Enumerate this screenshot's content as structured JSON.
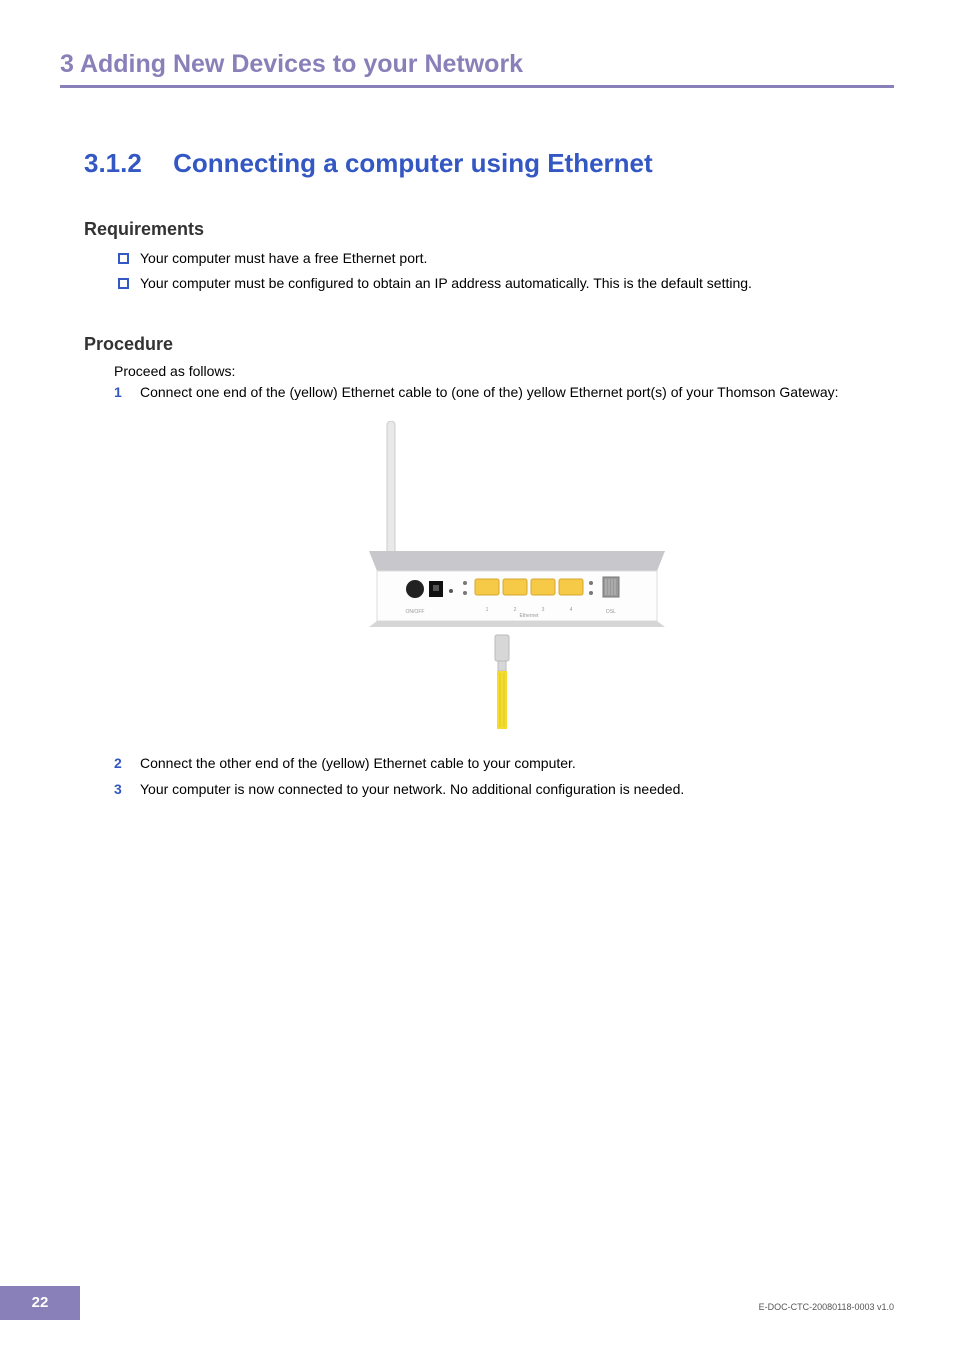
{
  "chapter": {
    "prefix": "3",
    "title": "Adding New Devices to your Network"
  },
  "section": {
    "number": "3.1.2",
    "title": "Connecting a computer using Ethernet"
  },
  "requirements": {
    "heading": "Requirements",
    "items": [
      "Your computer must have a free Ethernet port.",
      "Your computer must be configured to obtain an IP address automatically. This is the default setting."
    ]
  },
  "procedure": {
    "heading": "Procedure",
    "intro": "Proceed as follows:",
    "steps": [
      "Connect one end of the (yellow) Ethernet cable to (one of the) yellow Ethernet port(s) of your Thomson Gateway:",
      "Connect the other end of the (yellow) Ethernet cable to your computer.",
      "Your computer is now connected to your network. No additional configuration is needed."
    ]
  },
  "figure": {
    "labels": {
      "onoff": "ON/OFF",
      "ethernet": "Ethernet",
      "port1": "1",
      "port2": "2",
      "port3": "3",
      "port4": "4",
      "dsl": "DSL"
    }
  },
  "footer": {
    "page": "22",
    "docid": "E-DOC-CTC-20080118-0003 v1.0"
  }
}
